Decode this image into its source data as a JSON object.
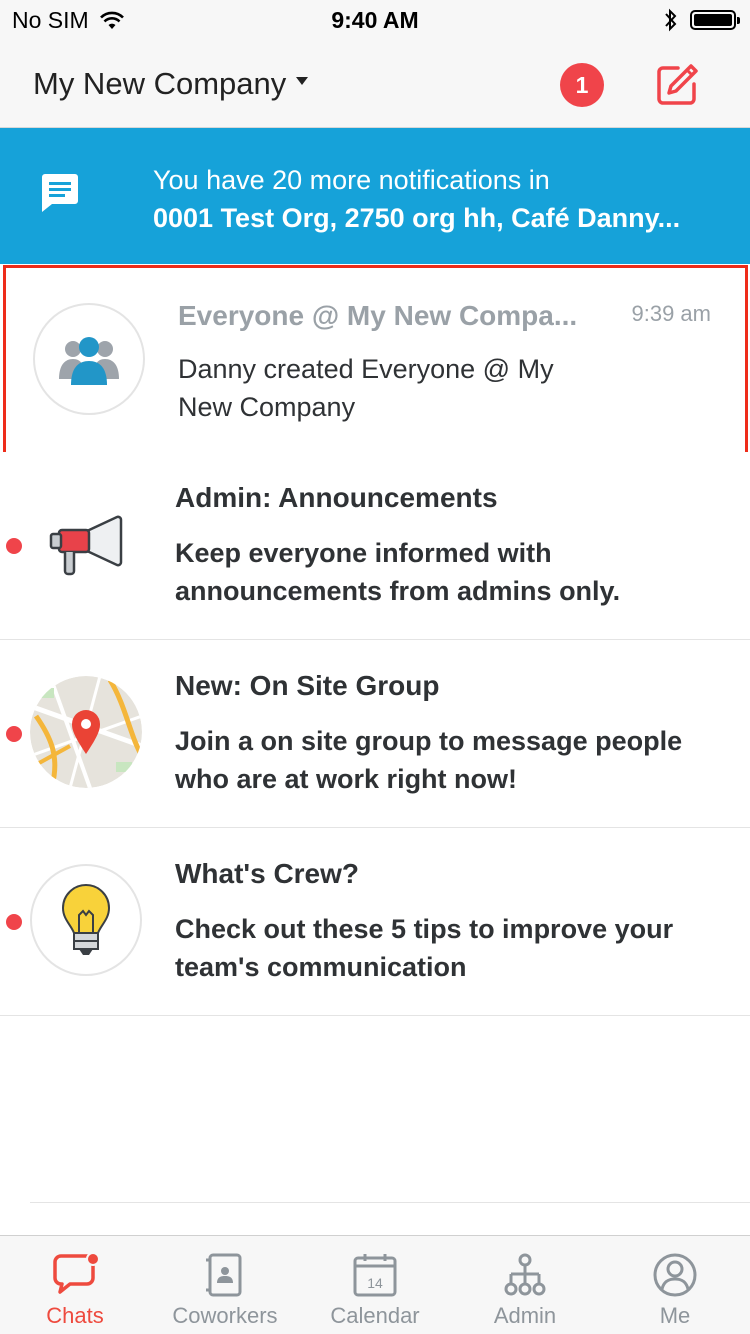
{
  "status_bar": {
    "carrier": "No SIM",
    "time": "9:40 AM"
  },
  "header": {
    "company_name": "My New Company",
    "notification_count": "1"
  },
  "banner": {
    "line1": "You have 20 more notifications in",
    "line2": "0001 Test Org, 2750 org hh, Café Danny..."
  },
  "chats": [
    {
      "title": "Everyone @ My New Compa...",
      "time": "9:39 am",
      "preview": "Danny created Everyone @ My New Company",
      "unread": false,
      "icon": "group-icon"
    },
    {
      "title": "Admin: Announcements",
      "preview": "Keep everyone informed with announcements from admins only.",
      "unread": true,
      "icon": "megaphone-icon"
    },
    {
      "title": "New: On Site Group",
      "preview": "Join a on site group to message people who are at work right now!",
      "unread": true,
      "icon": "map-pin-icon"
    },
    {
      "title": "What's Crew?",
      "preview": "Check out these 5 tips to improve your team's communication",
      "unread": true,
      "icon": "lightbulb-icon"
    }
  ],
  "tabs": [
    {
      "label": "Chats",
      "icon": "chat-bubble-icon",
      "active": true
    },
    {
      "label": "Coworkers",
      "icon": "contacts-icon",
      "active": false
    },
    {
      "label": "Calendar",
      "icon": "calendar-icon",
      "calendar_day": "14",
      "active": false
    },
    {
      "label": "Admin",
      "icon": "org-chart-icon",
      "active": false
    },
    {
      "label": "Me",
      "icon": "profile-icon",
      "active": false
    }
  ],
  "colors": {
    "accent_red": "#f0444a",
    "banner_blue": "#16a2d9",
    "highlight_border": "#ee2c1a"
  }
}
